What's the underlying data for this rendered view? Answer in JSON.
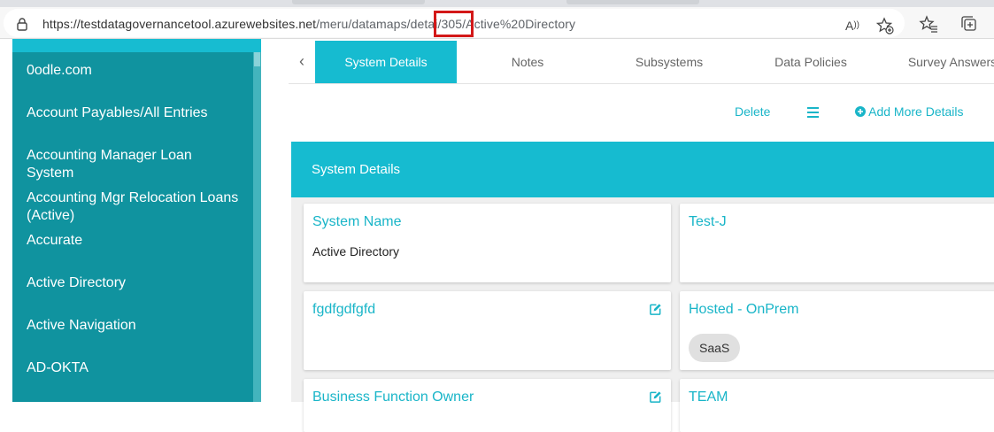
{
  "browser": {
    "url_host": "https://testdatagovernancetool.azurewebsites.net",
    "url_path_before": "/meru/datamaps/detai",
    "url_highlight": "/305/",
    "url_path_after": "Active%20Directory",
    "icons": [
      "lock-icon",
      "read-aloud-icon",
      "add-favorite-icon",
      "favorites-icon",
      "collections-icon"
    ]
  },
  "sidebar": {
    "items": [
      {
        "label": "0odle.com"
      },
      {
        "label": "Account Payables/All Entries"
      },
      {
        "label": "Accounting Manager Loan System"
      },
      {
        "label": "Accounting Mgr Relocation Loans (Active)"
      },
      {
        "label": "Accurate"
      },
      {
        "label": "Active Directory"
      },
      {
        "label": "Active Navigation"
      },
      {
        "label": "AD-OKTA"
      }
    ]
  },
  "tabs": [
    {
      "label": "System Details",
      "active": true
    },
    {
      "label": "Notes"
    },
    {
      "label": "Subsystems"
    },
    {
      "label": "Data Policies"
    },
    {
      "label": "Survey Answers"
    }
  ],
  "actions": {
    "delete_label": "Delete",
    "add_more_label": "Add More Details"
  },
  "panel": {
    "title": "System Details",
    "cards": {
      "system_name": {
        "label": "System Name",
        "value": "Active Directory"
      },
      "test_j": {
        "label": "Test-J"
      },
      "fgdfgdfgfd": {
        "label": "fgdfgdfgfd"
      },
      "hosted": {
        "label": "Hosted - OnPrem",
        "chip": "SaaS"
      },
      "business_function_owner": {
        "label": "Business Function Owner"
      },
      "team": {
        "label": "TEAM"
      }
    }
  },
  "colors": {
    "accent": "#16bbd0",
    "sidebar_bg": "#10939f",
    "link": "#19b5c8",
    "highlight": "#d31818"
  }
}
